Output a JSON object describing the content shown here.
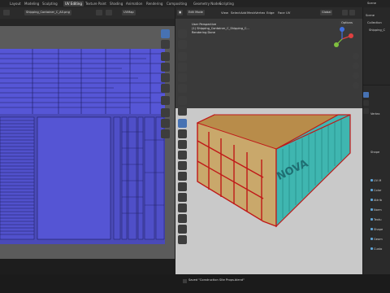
{
  "workspace_tabs": [
    {
      "label": "Layout",
      "active": false
    },
    {
      "label": "Modeling",
      "active": false
    },
    {
      "label": "Sculpting",
      "active": false
    },
    {
      "label": "UV Editing",
      "active": true
    },
    {
      "label": "Texture Paint",
      "active": false
    },
    {
      "label": "Shading",
      "active": false
    },
    {
      "label": "Animation",
      "active": false
    },
    {
      "label": "Rendering",
      "active": false
    },
    {
      "label": "Compositing",
      "active": false
    },
    {
      "label": "Geometry Nodes",
      "active": false
    },
    {
      "label": "Scripting",
      "active": false
    }
  ],
  "scene_label": "Scene",
  "uv_editor": {
    "image_name": "Shipping_Container_C_A0.png",
    "uvmap_label": "UVMap"
  },
  "viewport": {
    "mode_label": "Edit Mode",
    "menus": [
      "View",
      "Select",
      "Add",
      "Mesh",
      "Vertex",
      "Edge",
      "Face",
      "UV"
    ],
    "transform_label": "Global",
    "options_label": "Options",
    "overlay_lines": [
      "User Perspective",
      "(1) Shipping_Container_C_Shipping_C...",
      "Rendering Done"
    ],
    "container_text": "NOVA",
    "axis": {
      "x": "X",
      "y": "Y",
      "z": "Z"
    }
  },
  "outliner": {
    "items": [
      "Scene",
      "Collection",
      "Shipping_C"
    ]
  },
  "properties": {
    "rows": [
      "UV M",
      "Color",
      "Attrib",
      "Norm",
      "Textu",
      "Shape",
      "Geom",
      "Custo"
    ],
    "section_labels": [
      "Shape",
      "Vertex"
    ]
  },
  "status": {
    "message": "Saved \"Construction Site Props.blend\""
  },
  "colors": {
    "uv_fill": "#5050d0",
    "uv_line": "#1a1a50",
    "accent": "#4772b3",
    "container_teal": "#3fb6b0",
    "container_wood": "#c9a86b",
    "edge_red": "#d02020"
  }
}
